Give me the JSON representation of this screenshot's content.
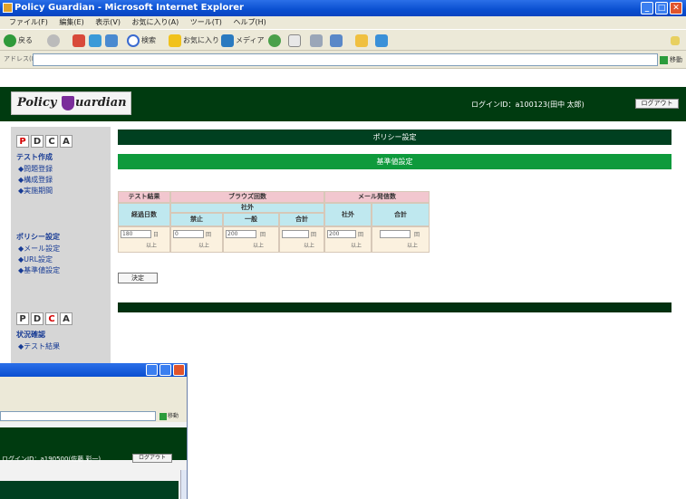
{
  "window": {
    "title": "Policy Guardian - Microsoft Internet Explorer"
  },
  "menu": [
    "ファイル(F)",
    "編集(E)",
    "表示(V)",
    "お気に入り(A)",
    "ツール(T)",
    "ヘルプ(H)"
  ],
  "toolbar": {
    "back": "戻る",
    "search": "検索",
    "favorites": "お気に入り",
    "media": "メディア"
  },
  "address": {
    "label": "アドレス(D)",
    "go": "移動"
  },
  "header": {
    "logo": "Policy Guardian",
    "login_info": "ログインID：a100123(田中 太郎)",
    "logout": "ログアウト"
  },
  "sidebar": {
    "pdca1": [
      "P",
      "D",
      "C",
      "A"
    ],
    "section1": "テスト作成",
    "section1_items": [
      "問題登録",
      "構成登録",
      "実施期間"
    ],
    "section2": "ポリシー設定",
    "section2_items": [
      "メール設定",
      "URL設定",
      "基準値設定"
    ],
    "pdca2": [
      "P",
      "D",
      "C",
      "A"
    ],
    "section3": "状況確認",
    "section3_items": [
      "テスト結果"
    ]
  },
  "main": {
    "bar_title": "ポリシー設定",
    "sub_title": "基準値設定",
    "table": {
      "group_test": "テスト結果",
      "group_browse": "ブラウズ回数",
      "group_mail": "メール発信数",
      "col_days": "経過日数",
      "col_external": "社外",
      "col_forbidden": "禁止",
      "col_general": "一般",
      "col_total": "合計",
      "col_mail_external": "社外",
      "col_mail_total": "合計",
      "input_days": "180",
      "input_forbidden": "0",
      "input_general": "200",
      "input_total": "",
      "input_mail_external": "200",
      "input_mail_total": "",
      "unit_days": "日",
      "unit_count": "回",
      "above": "以上"
    },
    "decide_button": "決定"
  },
  "window2": {
    "login_info": "ログインID：a190500(佐藤 彩一)",
    "logout": "ログアウト"
  },
  "colors": {
    "dark_green": "#003b10",
    "green_bar": "#0e9a3c",
    "pink_header": "#f2c7cf",
    "cyan_header": "#bfe8ef"
  }
}
